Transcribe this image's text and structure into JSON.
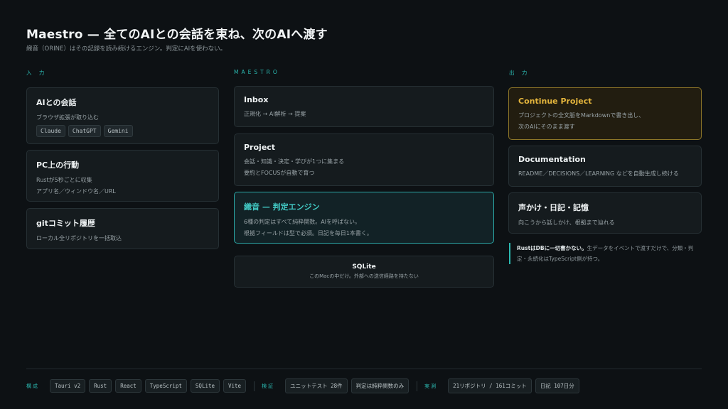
{
  "header": {
    "title": "Maestro — 全てのAIとの会話を束ね、次のAIへ渡す",
    "subtitle": "織音（ORINE）はその記録を読み続けるエンジン。判定にAIを使わない。"
  },
  "columns": {
    "input_label": "入 力",
    "maestro_label": "MAESTRO",
    "output_label": "出 力"
  },
  "input": [
    {
      "title": "AIとの会話",
      "lines": [
        "ブラウザ拡張が取り込む"
      ],
      "tags": [
        "Claude",
        "ChatGPT",
        "Gemini"
      ]
    },
    {
      "title": "PC上の行動",
      "lines": [
        "Rustが5秒ごとに収集",
        "アプリ名／ウィンドウ名／URL"
      ]
    },
    {
      "title": "gitコミット履歴",
      "lines": [
        "ローカル全リポジトリを一括取込"
      ]
    }
  ],
  "maestro": [
    {
      "title": "Inbox",
      "lines": [
        "正規化 → AI解析 → 提案"
      ]
    },
    {
      "title": "Project",
      "lines": [
        "会話・知識・決定・学びが1つに集まる",
        "要約とFOCUSが自動で育つ"
      ]
    },
    {
      "title": "織音 — 判定エンジン",
      "lines": [
        "6種の判定はすべて純粋関数。AIを呼ばない。",
        "根拠フィールドは型で必須。日記を毎日1本書く。"
      ]
    },
    {
      "title": "SQLite",
      "lines": [
        "このMacの中だけ。外部への送信経路を持たない"
      ]
    }
  ],
  "output": [
    {
      "title": "Continue Project",
      "lines": [
        "プロジェクトの全文脈をMarkdownで書き出し、",
        "次のAIにそのまま渡す"
      ]
    },
    {
      "title": "Documentation",
      "lines": [
        "README／DECISIONS／LEARNING などを自動生成し続ける"
      ]
    },
    {
      "title": "声かけ・日記・記憶",
      "lines": [
        "向こうから話しかけ、根拠まで辿れる"
      ]
    }
  ],
  "note": {
    "strong": "RustはDBに一切書かない。",
    "rest": "生データをイベントで渡すだけで、分類・判定・永続化はTypeScript側が持つ。"
  },
  "footer": {
    "stack_label": "構成",
    "stack": [
      "Tauri v2",
      "Rust",
      "React",
      "TypeScript",
      "SQLite",
      "Vite"
    ],
    "verify_label": "検証",
    "verify": [
      "ユニットテスト 28件",
      "判定は純粋関数のみ"
    ],
    "actual_label": "実測",
    "actual": [
      "21リポジトリ / 161コミット",
      "日記 107日分"
    ]
  },
  "colors": {
    "accent_teal": "#2bb8b0",
    "accent_gold": "#e3b43c",
    "background": "#0d1114"
  }
}
